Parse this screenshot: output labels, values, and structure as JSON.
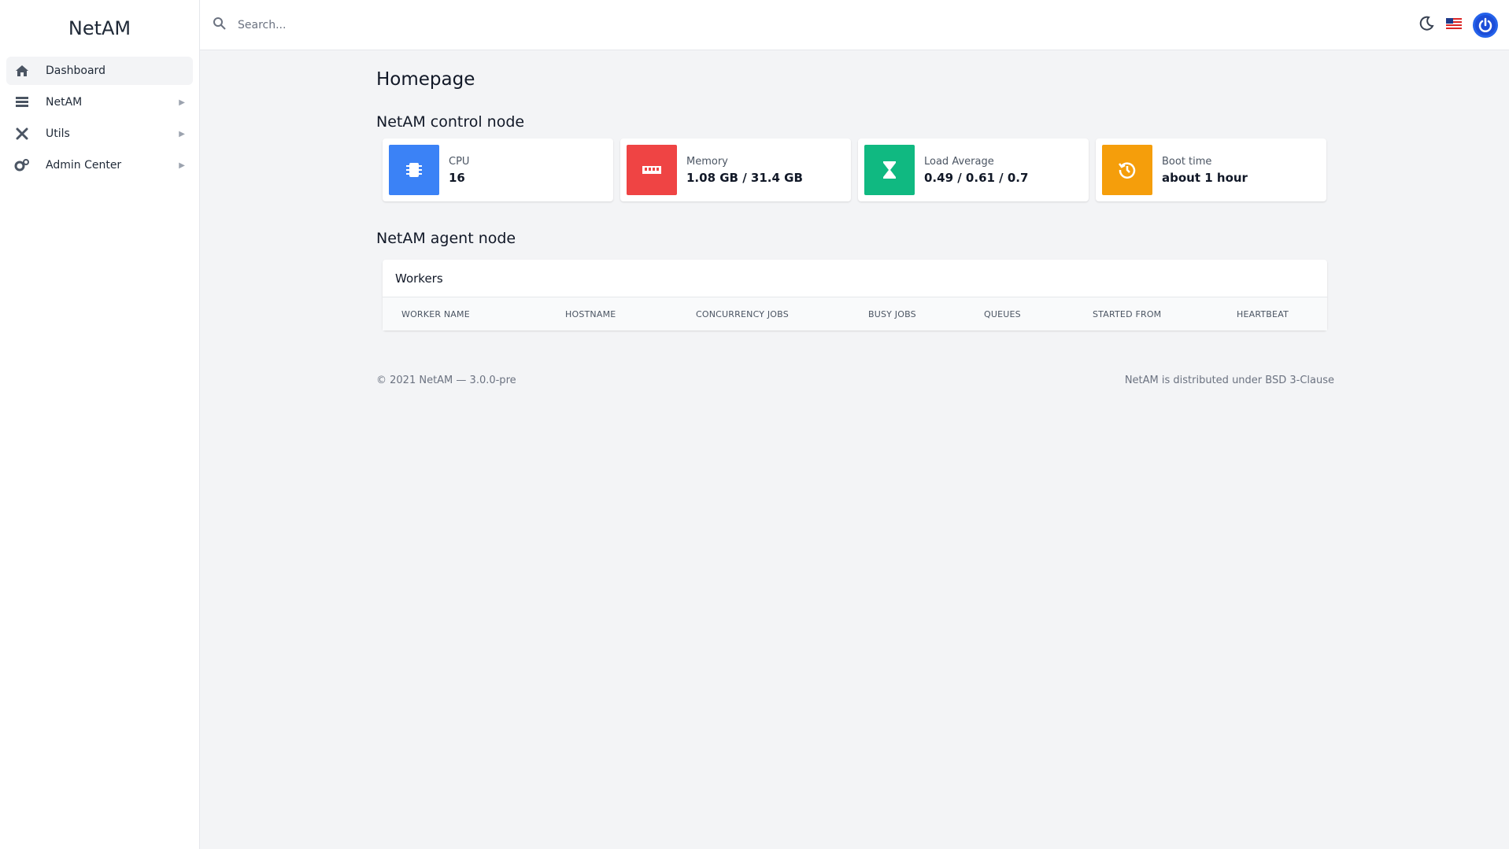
{
  "sidebar": {
    "brand": "NetAM",
    "items": [
      {
        "label": "Dashboard",
        "icon": "home-icon",
        "active": true
      },
      {
        "label": "NetAM",
        "icon": "list-icon"
      },
      {
        "label": "Utils",
        "icon": "tools-icon"
      },
      {
        "label": "Admin Center",
        "icon": "cogs-icon"
      }
    ]
  },
  "topbar": {
    "search_placeholder": "Search...",
    "icons": [
      "search-icon",
      "moon-icon",
      "us-flag-icon",
      "power-icon"
    ]
  },
  "main": {
    "title": "Homepage",
    "control_node": {
      "title": "NetAM control node",
      "cards": [
        {
          "label": "CPU",
          "value": "16",
          "icon": "chip-icon",
          "color": "#3b82f6"
        },
        {
          "label": "Memory",
          "value": "1.08 GB / 31.4 GB",
          "icon": "memory-icon",
          "color": "#ef4444"
        },
        {
          "label": "Load Average",
          "value": "0.49 / 0.61 / 0.7",
          "icon": "hourglass-icon",
          "color": "#10b981"
        },
        {
          "label": "Boot time",
          "value": "about 1 hour",
          "icon": "history-icon",
          "color": "#f59e0b"
        }
      ]
    },
    "agent_node": {
      "title": "NetAM agent node",
      "workers_title": "Workers",
      "columns": [
        "WORKER NAME",
        "HOSTNAME",
        "CONCURRENCY JOBS",
        "BUSY JOBS",
        "QUEUES",
        "STARTED FROM",
        "HEARTBEAT"
      ]
    }
  },
  "footer": {
    "left": "© 2021 NetAM — 3.0.0-pre",
    "right": "NetAM is distributed under BSD 3-Clause"
  }
}
